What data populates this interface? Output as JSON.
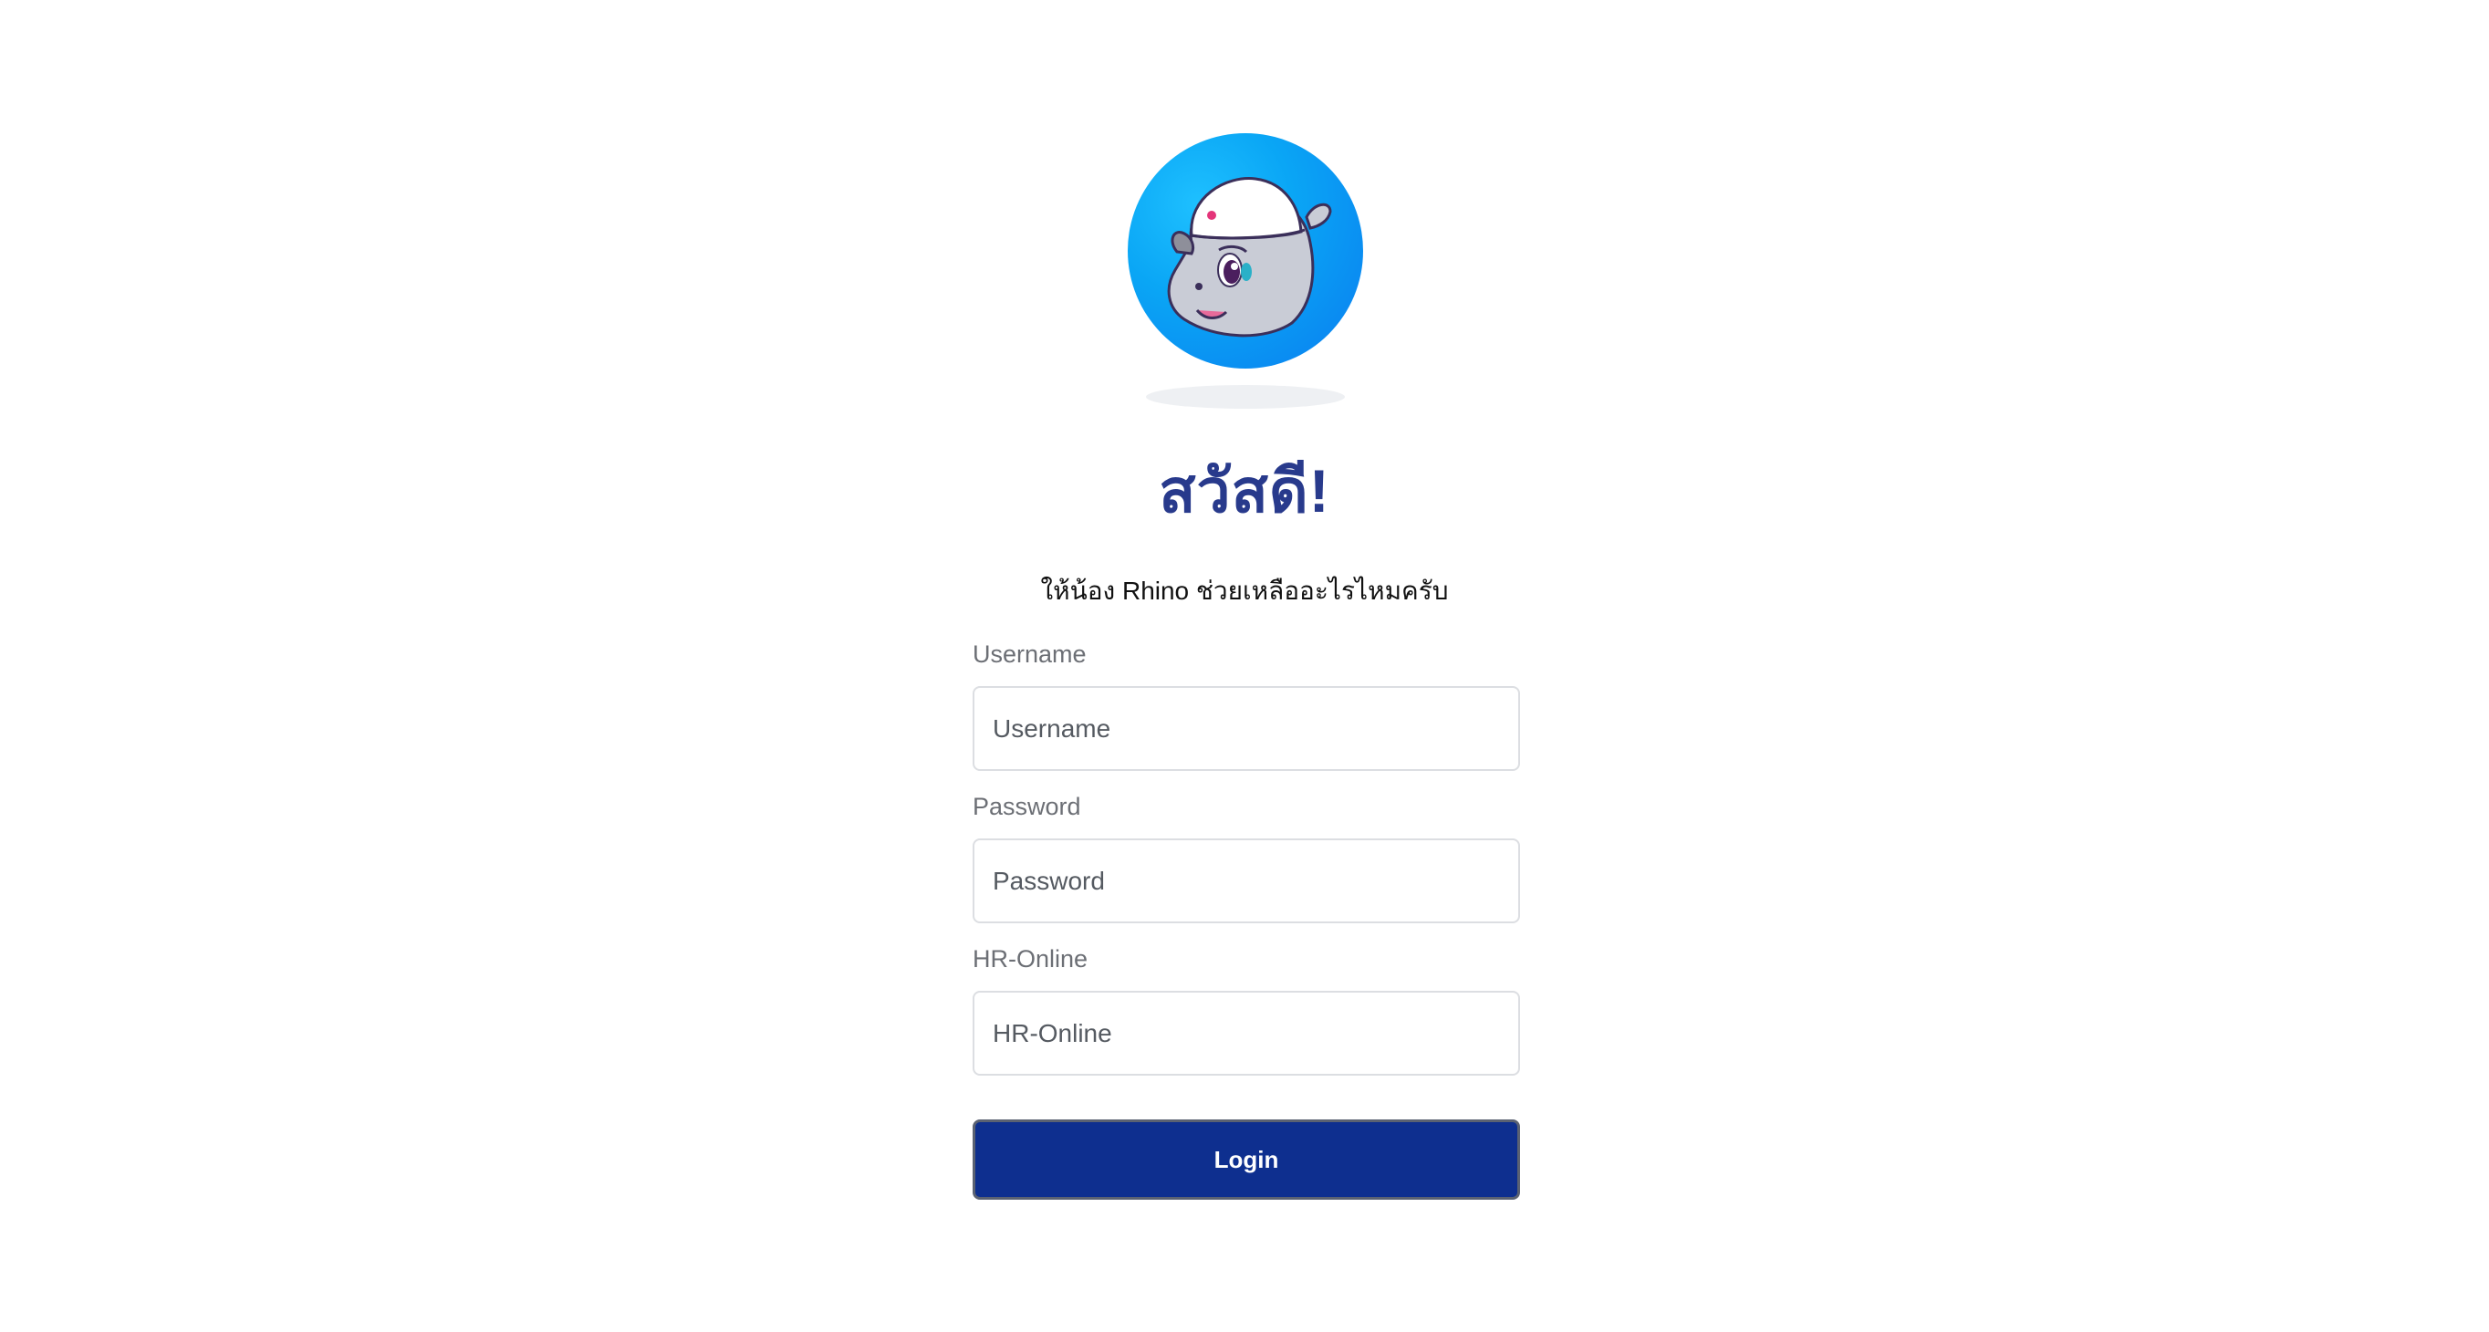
{
  "header": {
    "avatar_icon": "rhino-mascot-icon",
    "greeting": "สวัสดี!",
    "subtitle": "ให้น้อง Rhino ช่วยเหลืออะไรไหมครับ"
  },
  "form": {
    "username": {
      "label": "Username",
      "placeholder": "Username",
      "value": ""
    },
    "password": {
      "label": "Password",
      "placeholder": "Password",
      "value": ""
    },
    "hr_online": {
      "label": "HR-Online",
      "placeholder": "HR-Online",
      "value": ""
    },
    "login_label": "Login"
  },
  "colors": {
    "accent": "#0e2f8f",
    "greeting": "#283a8c",
    "avatar_bg": "#0a9df5"
  }
}
